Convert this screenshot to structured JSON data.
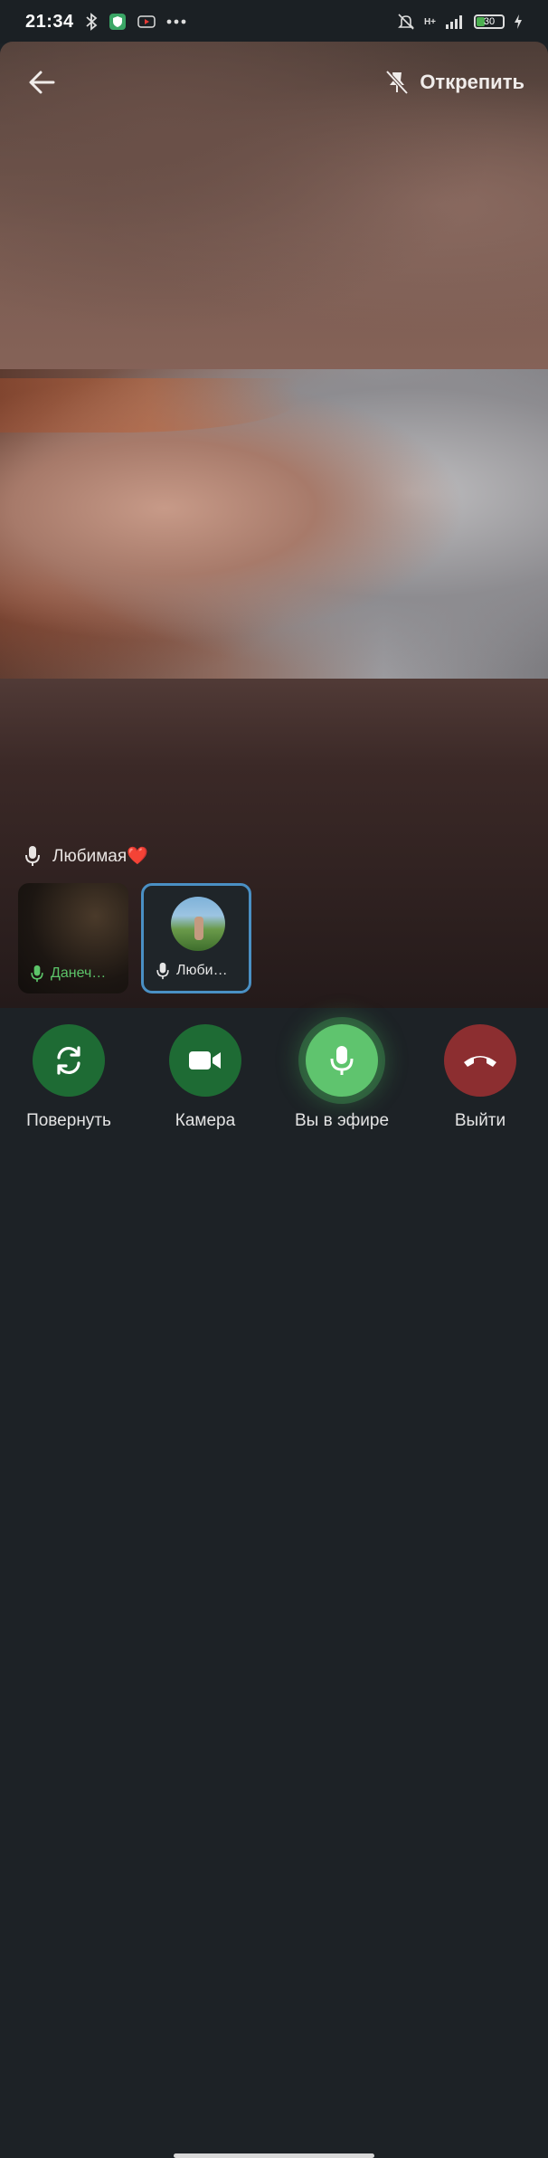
{
  "status_bar": {
    "time": "21:34",
    "battery": "30",
    "network": "H+",
    "icons": [
      "bluetooth-icon",
      "vpn-shield-icon",
      "youtube-icon",
      "more-dots-icon",
      "bell-off-icon",
      "signal-icon",
      "battery-icon",
      "charging-icon"
    ]
  },
  "header": {
    "unpin_label": "Открепить"
  },
  "speaker": {
    "name": "Любимая❤️"
  },
  "participants": [
    {
      "name": "Данеч…",
      "mic": "active"
    },
    {
      "name": "Люби…",
      "mic": "muted",
      "selected": true
    }
  ],
  "controls": {
    "rotate_label": "Повернуть",
    "camera_label": "Камера",
    "live_label": "Вы в эфире",
    "leave_label": "Выйти"
  },
  "colors": {
    "accent_green": "#5fc46e",
    "dark_green": "#1e6b34",
    "leave_red": "#8c2e30",
    "selected_border": "#4a90c4"
  }
}
